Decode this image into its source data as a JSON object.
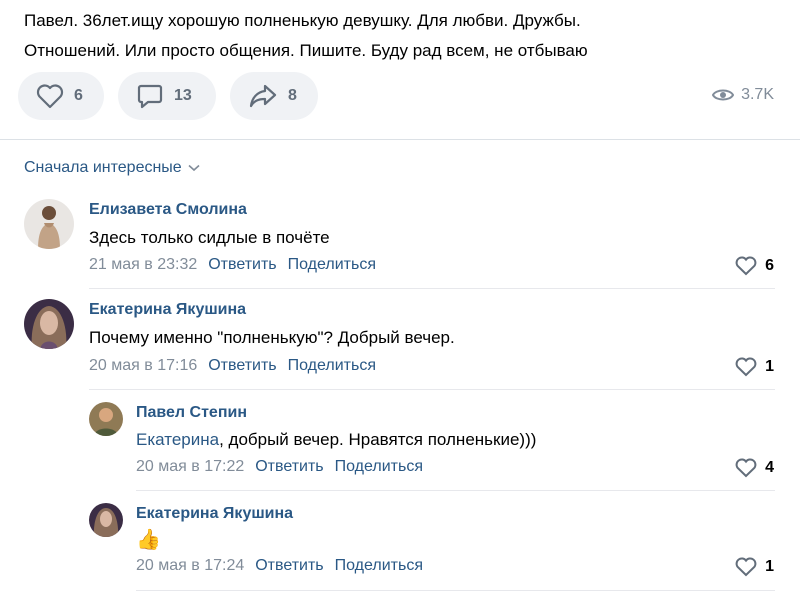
{
  "post": {
    "text_line1": "Павел. 36лет.ищу хорошую полненькую девушку. Для любви. Дружбы.",
    "text_line2": "Отношений. Или просто общения. Пишите. Буду рад всем, не отбываю",
    "likes": "6",
    "comments": "13",
    "shares": "8",
    "views": "3.7K"
  },
  "sort_label": "Сначала интересные",
  "actions": {
    "reply": "Ответить",
    "share": "Поделиться"
  },
  "comments": [
    {
      "author": "Елизавета Смолина",
      "text": "Здесь только сидлые в почёте",
      "date": "21 мая в 23:32",
      "likes": "6"
    },
    {
      "author": "Екатерина Якушина",
      "text": "Почему именно \"полненькую\"? Добрый вечер.",
      "date": "20 мая в 17:16",
      "likes": "1"
    },
    {
      "author": "Павел Степин",
      "mention": "Екатерина",
      "text": ", добрый вечер. Нравятся полненькие)))",
      "date": "20 мая в 17:22",
      "likes": "4"
    },
    {
      "author": "Екатерина Якушина",
      "text": "👍",
      "date": "20 мая в 17:24",
      "likes": "1"
    }
  ],
  "colors": {
    "link": "#2a5885",
    "muted": "#818c99",
    "pill_bg": "#f0f2f5",
    "divider": "#dce1e6"
  }
}
